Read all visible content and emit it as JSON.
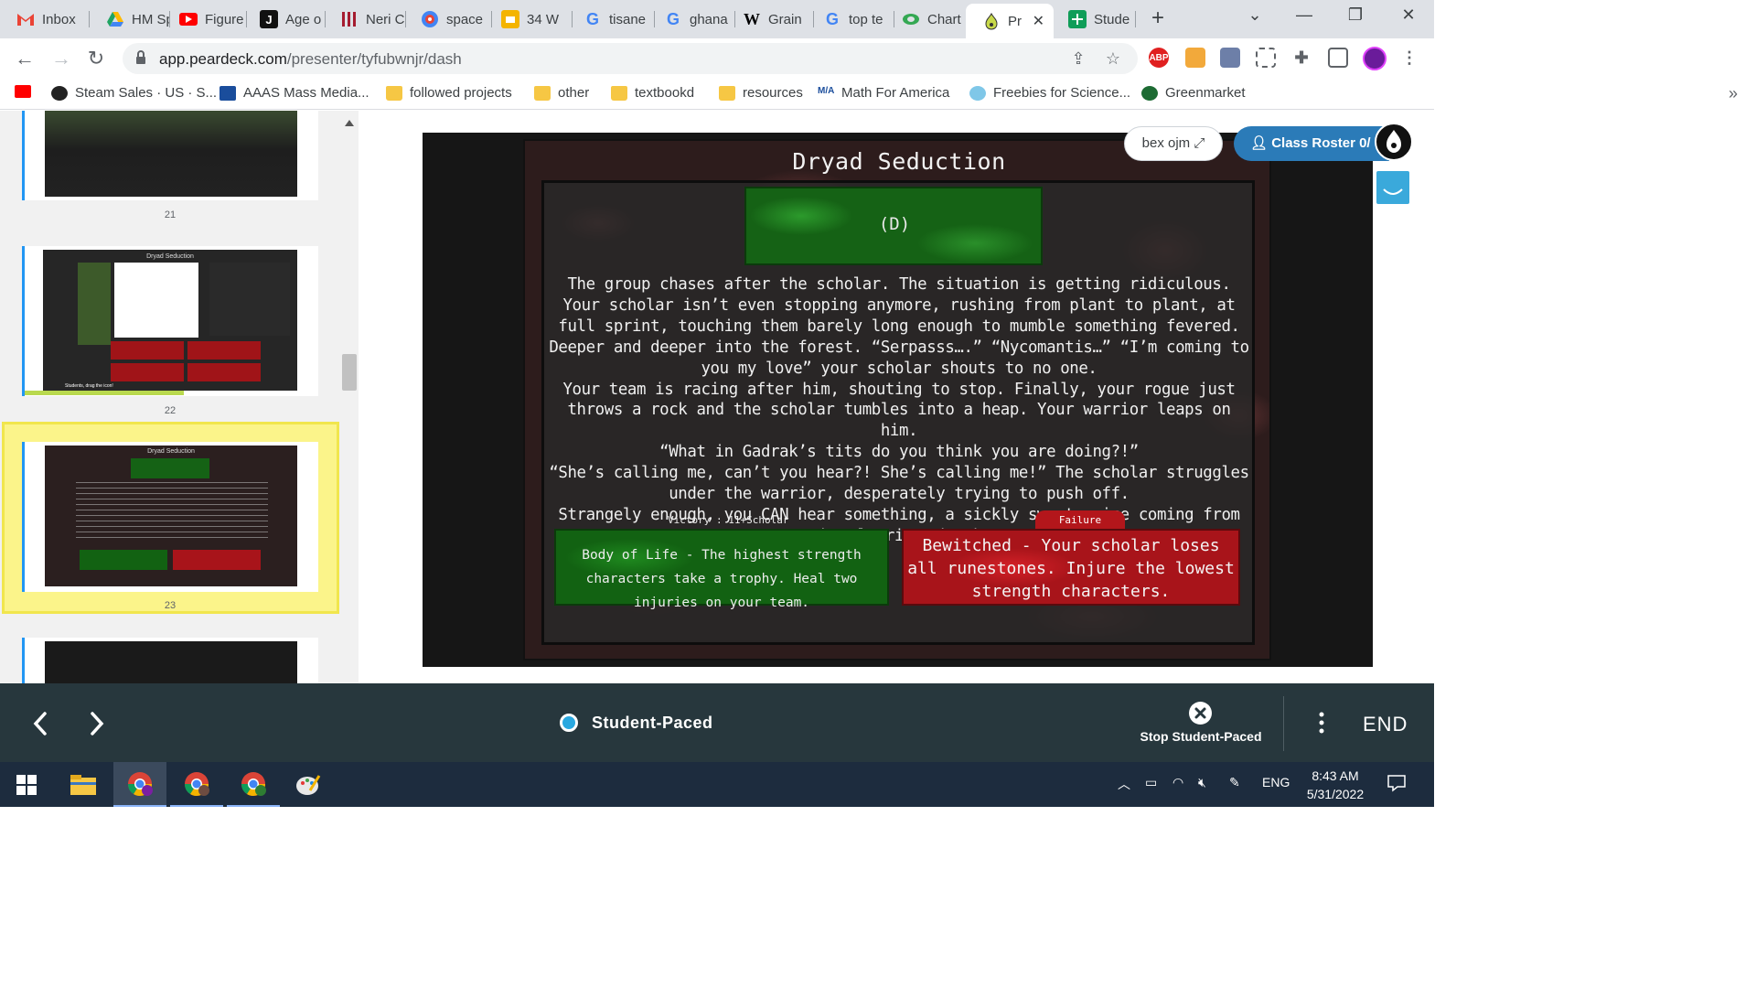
{
  "browser": {
    "tabs": [
      {
        "label": "Inbox",
        "icon": "gmail-icon",
        "color": "#ea4335"
      },
      {
        "label": "HM Sp",
        "icon": "drive-icon",
        "color": "#1fa463"
      },
      {
        "label": "Figure",
        "icon": "youtube-icon",
        "color": "#ff0000"
      },
      {
        "label": "Age o",
        "icon": "j-icon",
        "color": "#111111"
      },
      {
        "label": "Neri C",
        "icon": "library-icon",
        "color": "#a51c30"
      },
      {
        "label": "space",
        "icon": "space-icon",
        "color": "#4285f4"
      },
      {
        "label": "34 W",
        "icon": "slides-icon",
        "color": "#f4b400"
      },
      {
        "label": "tisane",
        "icon": "google-icon",
        "color": "#4285f4"
      },
      {
        "label": "ghana",
        "icon": "google-icon",
        "color": "#4285f4"
      },
      {
        "label": "Grain",
        "icon": "wikipedia-icon",
        "color": "#000000"
      },
      {
        "label": "top te",
        "icon": "google-icon",
        "color": "#4285f4"
      },
      {
        "label": "Chart",
        "icon": "chart-icon",
        "color": "#34a853"
      },
      {
        "label": "Pr",
        "icon": "peardeck-icon",
        "color": "#9bbf3a",
        "active": true
      },
      {
        "label": "Stude",
        "icon": "classroom-icon",
        "color": "#0f9d58"
      }
    ],
    "url_host": "app.peardeck.com",
    "url_path": "/presenter/tyfubwnjr/dash",
    "bookmarks": [
      {
        "label": "",
        "icon": "youtube-icon"
      },
      {
        "label": "Steam Sales · US · S...",
        "icon": "steamdb-icon"
      },
      {
        "label": "AAAS Mass Media...",
        "icon": "aaas-icon"
      },
      {
        "label": "followed projects",
        "icon": "folder-icon"
      },
      {
        "label": "other",
        "icon": "folder-icon"
      },
      {
        "label": "textbookd",
        "icon": "folder-icon"
      },
      {
        "label": "resources",
        "icon": "folder-icon"
      },
      {
        "label": "Math For America",
        "icon": "mfa-icon"
      },
      {
        "label": "Freebies for Science...",
        "icon": "freebies-icon"
      },
      {
        "label": "Greenmarket",
        "icon": "greenmarket-icon"
      }
    ],
    "bookmarks_more": "»",
    "extensions": {
      "abp": "ABP"
    }
  },
  "sidebar": {
    "slide_numbers": [
      "21",
      "22",
      "23"
    ],
    "thumb22": {
      "title": "Dryad Seduction",
      "footer": "Students, drag the icon!"
    },
    "thumb23": {
      "title": "Dryad Seduction"
    }
  },
  "slide": {
    "title": "Dryad Seduction",
    "choice_label": "(D)",
    "story": [
      "The group chases after the scholar. The situation is getting ridiculous. Your scholar isn’t even stopping anymore, rushing from plant to plant, at full sprint, touching them barely long enough to mumble something fevered. Deeper and deeper into the forest. “Serpasss….” “Nycomantis…” “I’m coming to you my love” your scholar shouts to no one.",
      "Your team is racing after him, shouting to stop. Finally, your rogue just throws a rock and the scholar tumbles into a heap. Your warrior leaps on him.",
      "“What in Gadrak’s tits do you think you are doing?!”",
      "“She’s calling me, can’t you hear?! She’s calling me!” The scholar struggles under the warrior, desperately trying to push off.",
      "Strangely enough, you CAN hear something, a sickly sweet voice coming from the clearing ahead."
    ],
    "victory_label": "Victory : 11+Scholar",
    "victory_text": "Body of Life - The highest strength characters take a trophy. Heal two injuries on your team.",
    "failure_label": "Failure",
    "failure_text": "Bewitched - Your scholar loses all runestones. Injure the lowest strength characters."
  },
  "header": {
    "user_button": "bex ojm ⤢",
    "roster_button": "Class Roster 0/"
  },
  "presenter": {
    "mode_label": "Student-Paced",
    "stop_label": "Stop Student-Paced",
    "end_label": "END"
  },
  "taskbar": {
    "language": "ENG",
    "time": "8:43 AM",
    "date": "5/31/2022"
  },
  "colors": {
    "tabstrip": "#dee1e6",
    "presenter_bar": "#27373d",
    "taskbar": "#1d2c3e",
    "selected_thumb": "#fbf48a",
    "victory_green": "#126212",
    "failure_red": "#a8141a",
    "roster_blue": "#2b7bb8"
  }
}
